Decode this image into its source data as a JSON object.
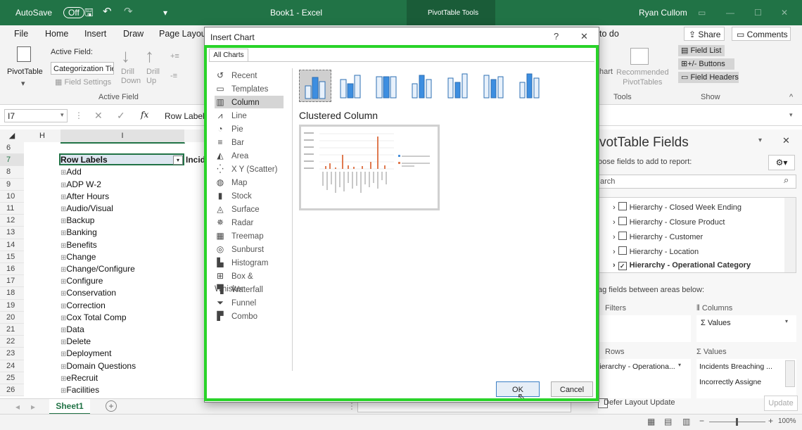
{
  "titlebar": {
    "autosave": "AutoSave",
    "toggle": "Off",
    "doc": "Book1  -  Excel",
    "context_tab": "PivotTable Tools",
    "user": "Ryan Cullom"
  },
  "ribbon_tabs": [
    "File",
    "Home",
    "Insert",
    "Draw",
    "Page Layout"
  ],
  "ribbon": {
    "pivot_btn": "PivotTable",
    "active_field_label": "Active Field:",
    "active_field_value": "Categorization Tie",
    "field_settings": "Field Settings",
    "drill_down": "Drill\nDown",
    "drill_up": "Drill\nUp",
    "group_active_field": "Active Field",
    "tell_me": "to do",
    "share": "Share",
    "comments": "Comments",
    "chart_partial": "hart",
    "recommended": "Recommended\nPivotTables",
    "tools_group": "Tools",
    "field_list": "Field List",
    "buttons": "+/- Buttons",
    "field_headers": "Field Headers",
    "show_group": "Show"
  },
  "formula_bar": {
    "namebox": "I7",
    "fx": "fx",
    "content": "Row Label"
  },
  "grid": {
    "col_h": "H",
    "col_i": "I",
    "row_numbers": [
      "6",
      "7",
      "8",
      "9",
      "10",
      "11",
      "12",
      "13",
      "14",
      "15",
      "16",
      "17",
      "18",
      "19",
      "20",
      "21",
      "22",
      "23",
      "24",
      "25",
      "26"
    ],
    "header_cell": "Row Labels",
    "header_next": "Incid",
    "items": [
      "Add",
      "ADP W-2",
      "After Hours",
      "Audio/Visual",
      "Backup",
      "Banking",
      "Benefits",
      "Change",
      "Change/Configure",
      "Configure",
      "Conservation",
      "Correction",
      "Cox Total Comp",
      "Data",
      "Delete",
      "Deployment",
      "Domain Questions",
      "eRecruit",
      "Facilities"
    ]
  },
  "sheet": {
    "tab": "Sheet1",
    "add": "+"
  },
  "status": {
    "zoom": "100%"
  },
  "dialog": {
    "title": "Insert Chart",
    "help": "?",
    "close": "✕",
    "tab": "All Charts",
    "chart_types": [
      "Recent",
      "Templates",
      "Column",
      "Line",
      "Pie",
      "Bar",
      "Area",
      "X Y (Scatter)",
      "Map",
      "Stock",
      "Surface",
      "Radar",
      "Treemap",
      "Sunburst",
      "Histogram",
      "Box & Whisker",
      "Waterfall",
      "Funnel",
      "Combo"
    ],
    "chart_type_icons": [
      "recent-icon",
      "templates-icon",
      "column-icon",
      "line-icon",
      "pie-icon",
      "bar-icon",
      "area-icon",
      "scatter-icon",
      "map-icon",
      "stock-icon",
      "surface-icon",
      "radar-icon",
      "treemap-icon",
      "sunburst-icon",
      "histogram-icon",
      "box-whisker-icon",
      "waterfall-icon",
      "funnel-icon",
      "combo-icon"
    ],
    "selected_index": 2,
    "preview_title": "Clustered Column",
    "ok": "OK",
    "cancel": "Cancel"
  },
  "pane": {
    "title": "votTable Fields",
    "subtitle": "oose fields to add to report:",
    "search": "arch",
    "fields": [
      {
        "label": "Hierarchy - Closed Week Ending",
        "checked": false,
        "bold": false
      },
      {
        "label": "Hierarchy - Closure Product",
        "checked": false,
        "bold": false
      },
      {
        "label": "Hierarchy - Customer",
        "checked": false,
        "bold": false
      },
      {
        "label": "Hierarchy - Location",
        "checked": false,
        "bold": false
      },
      {
        "label": "Hierarchy - Operational Category",
        "checked": true,
        "bold": true
      }
    ],
    "drag_label": "ag fields between areas below:",
    "filters": "Filters",
    "columns": "Columns",
    "columns_value": "Σ Values",
    "rows": "Rows",
    "values": "Values",
    "rows_value": "lierarchy - Operationa...",
    "values_1": "Incidents Breaching ...",
    "values_2": "Incorrectly Assigne",
    "defer": "Defer Layout Update",
    "update": "Update"
  }
}
